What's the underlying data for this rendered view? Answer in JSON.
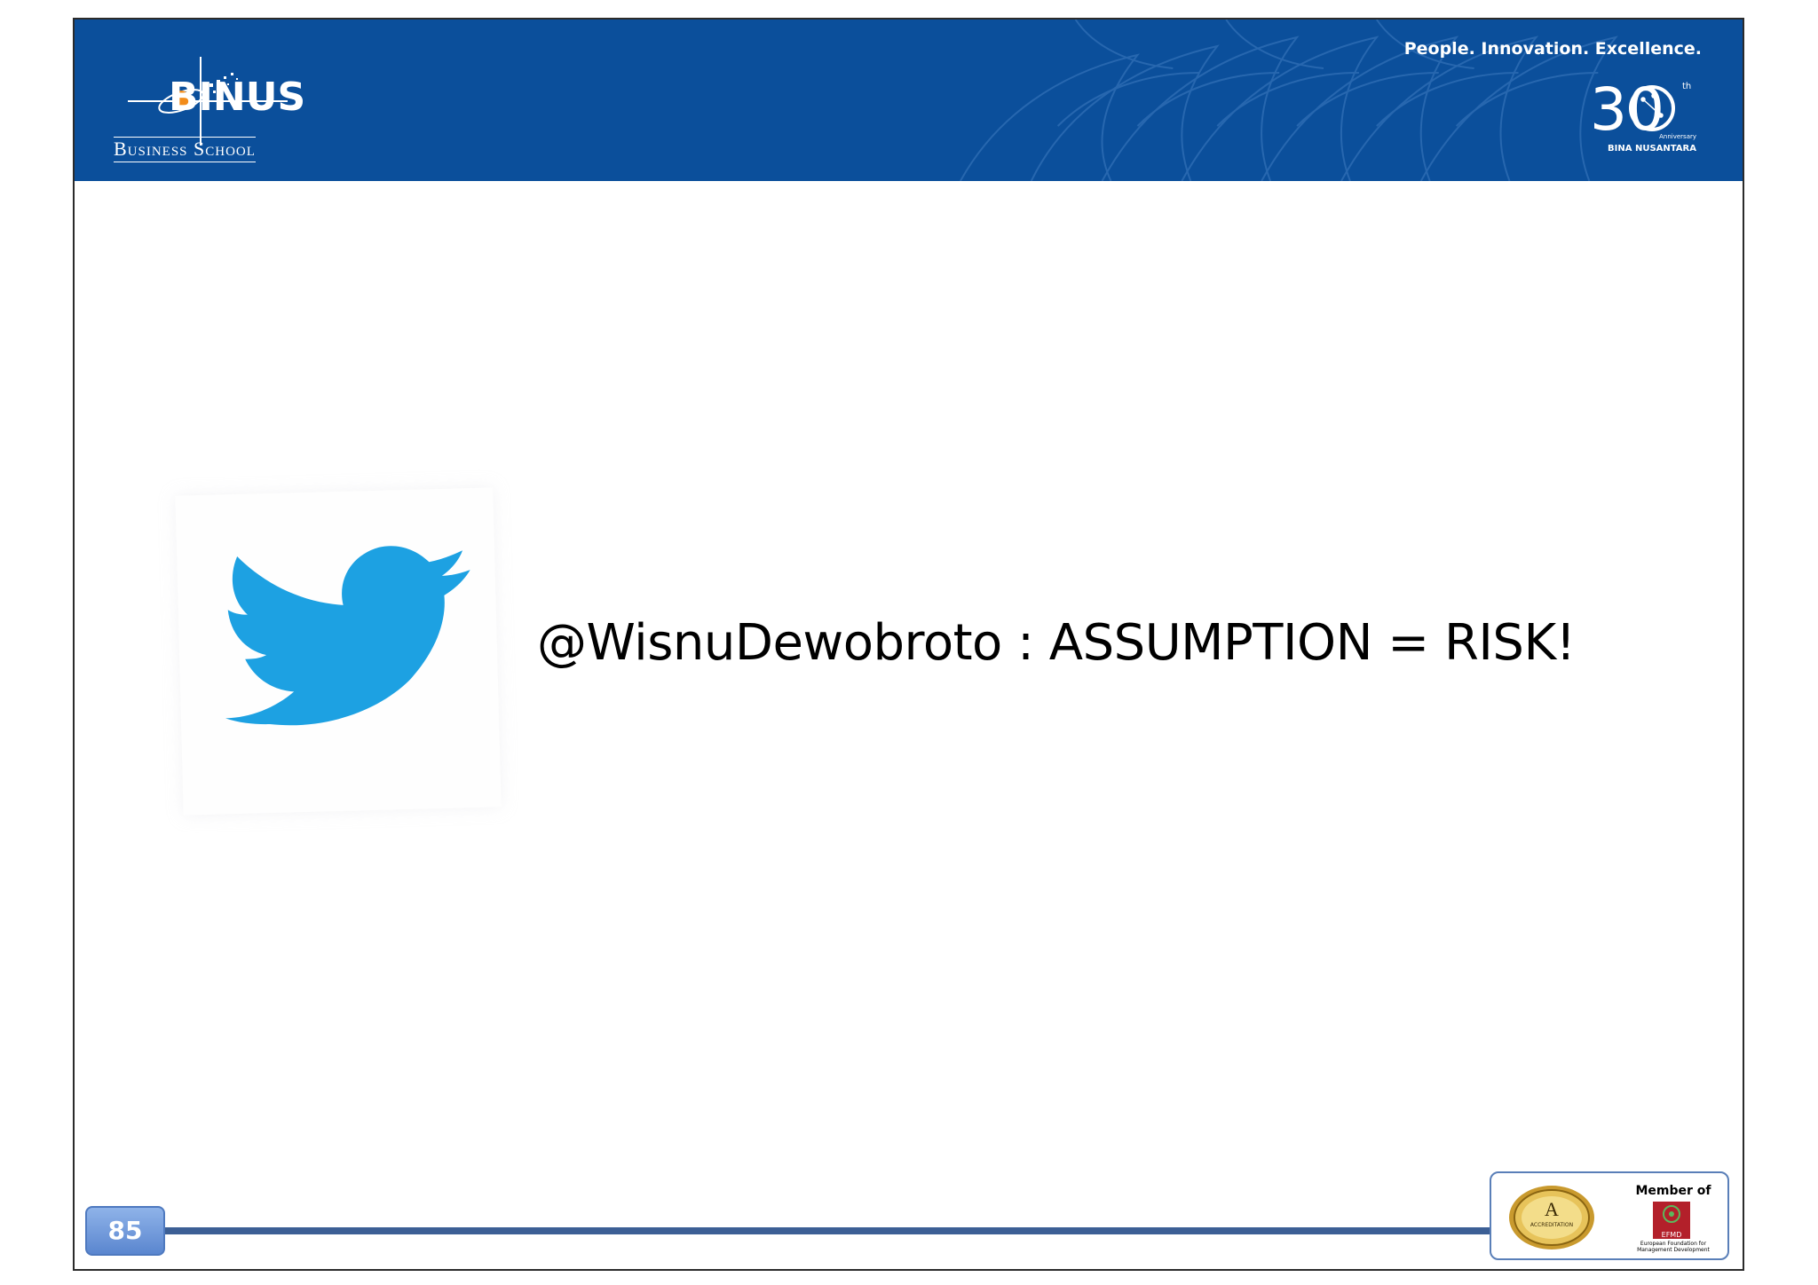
{
  "header": {
    "logo_word": "BINUS",
    "logo_sub": "Business School",
    "tagline": "People. Innovation. Excellence.",
    "anniversary_number": "30",
    "anniversary_sup": "th",
    "anniversary_note": "Anniversary",
    "anniversary_org": "BINA NUSANTARA",
    "brand_color": "#0b4f9b"
  },
  "main": {
    "headline": "@WisnuDewobroto : ASSUMPTION = RISK!",
    "image_icon": "twitter-bird-icon",
    "image_color": "#1da1e2"
  },
  "footer": {
    "page_number": "85",
    "member_label": "Member of",
    "accreditation_letter": "A",
    "accreditation_text": "ACCREDITATION",
    "efmd_name": "EFMD",
    "efmd_caption": "European Foundation for Management Development"
  }
}
